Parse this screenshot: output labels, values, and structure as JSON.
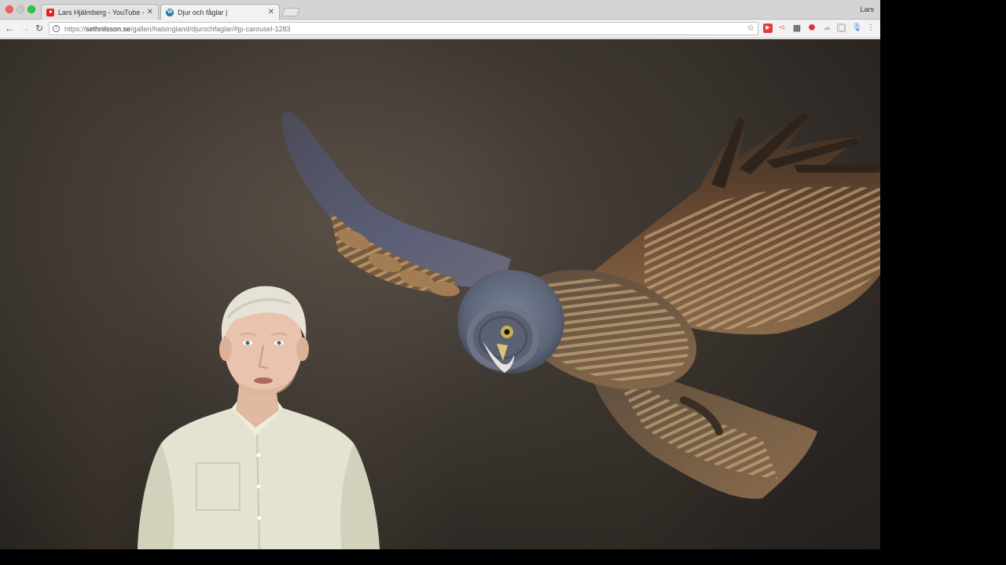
{
  "window": {
    "profile_name": "Lars"
  },
  "tabs": [
    {
      "title": "Lars Hjälmberg - YouTube - Yo",
      "favicon": "youtube-icon",
      "active": false
    },
    {
      "title": "Djur och fåglar |",
      "favicon": "wordpress-icon",
      "active": true
    }
  ],
  "toolbar": {
    "url_scheme": "https://",
    "url_host": "sethnilsson.se",
    "url_path": "/galleri/halsingland/djurochfaglar/#jp-carousel-1283"
  },
  "extensions": [
    "youtube-extension-icon",
    "cast-icon",
    "qr-code-icon",
    "adblock-icon",
    "cloud-icon",
    "screenshot-icon",
    "microphone-icon"
  ],
  "page": {
    "photo": "great-grey-owl-in-flight",
    "overlay": "presenter-video"
  }
}
